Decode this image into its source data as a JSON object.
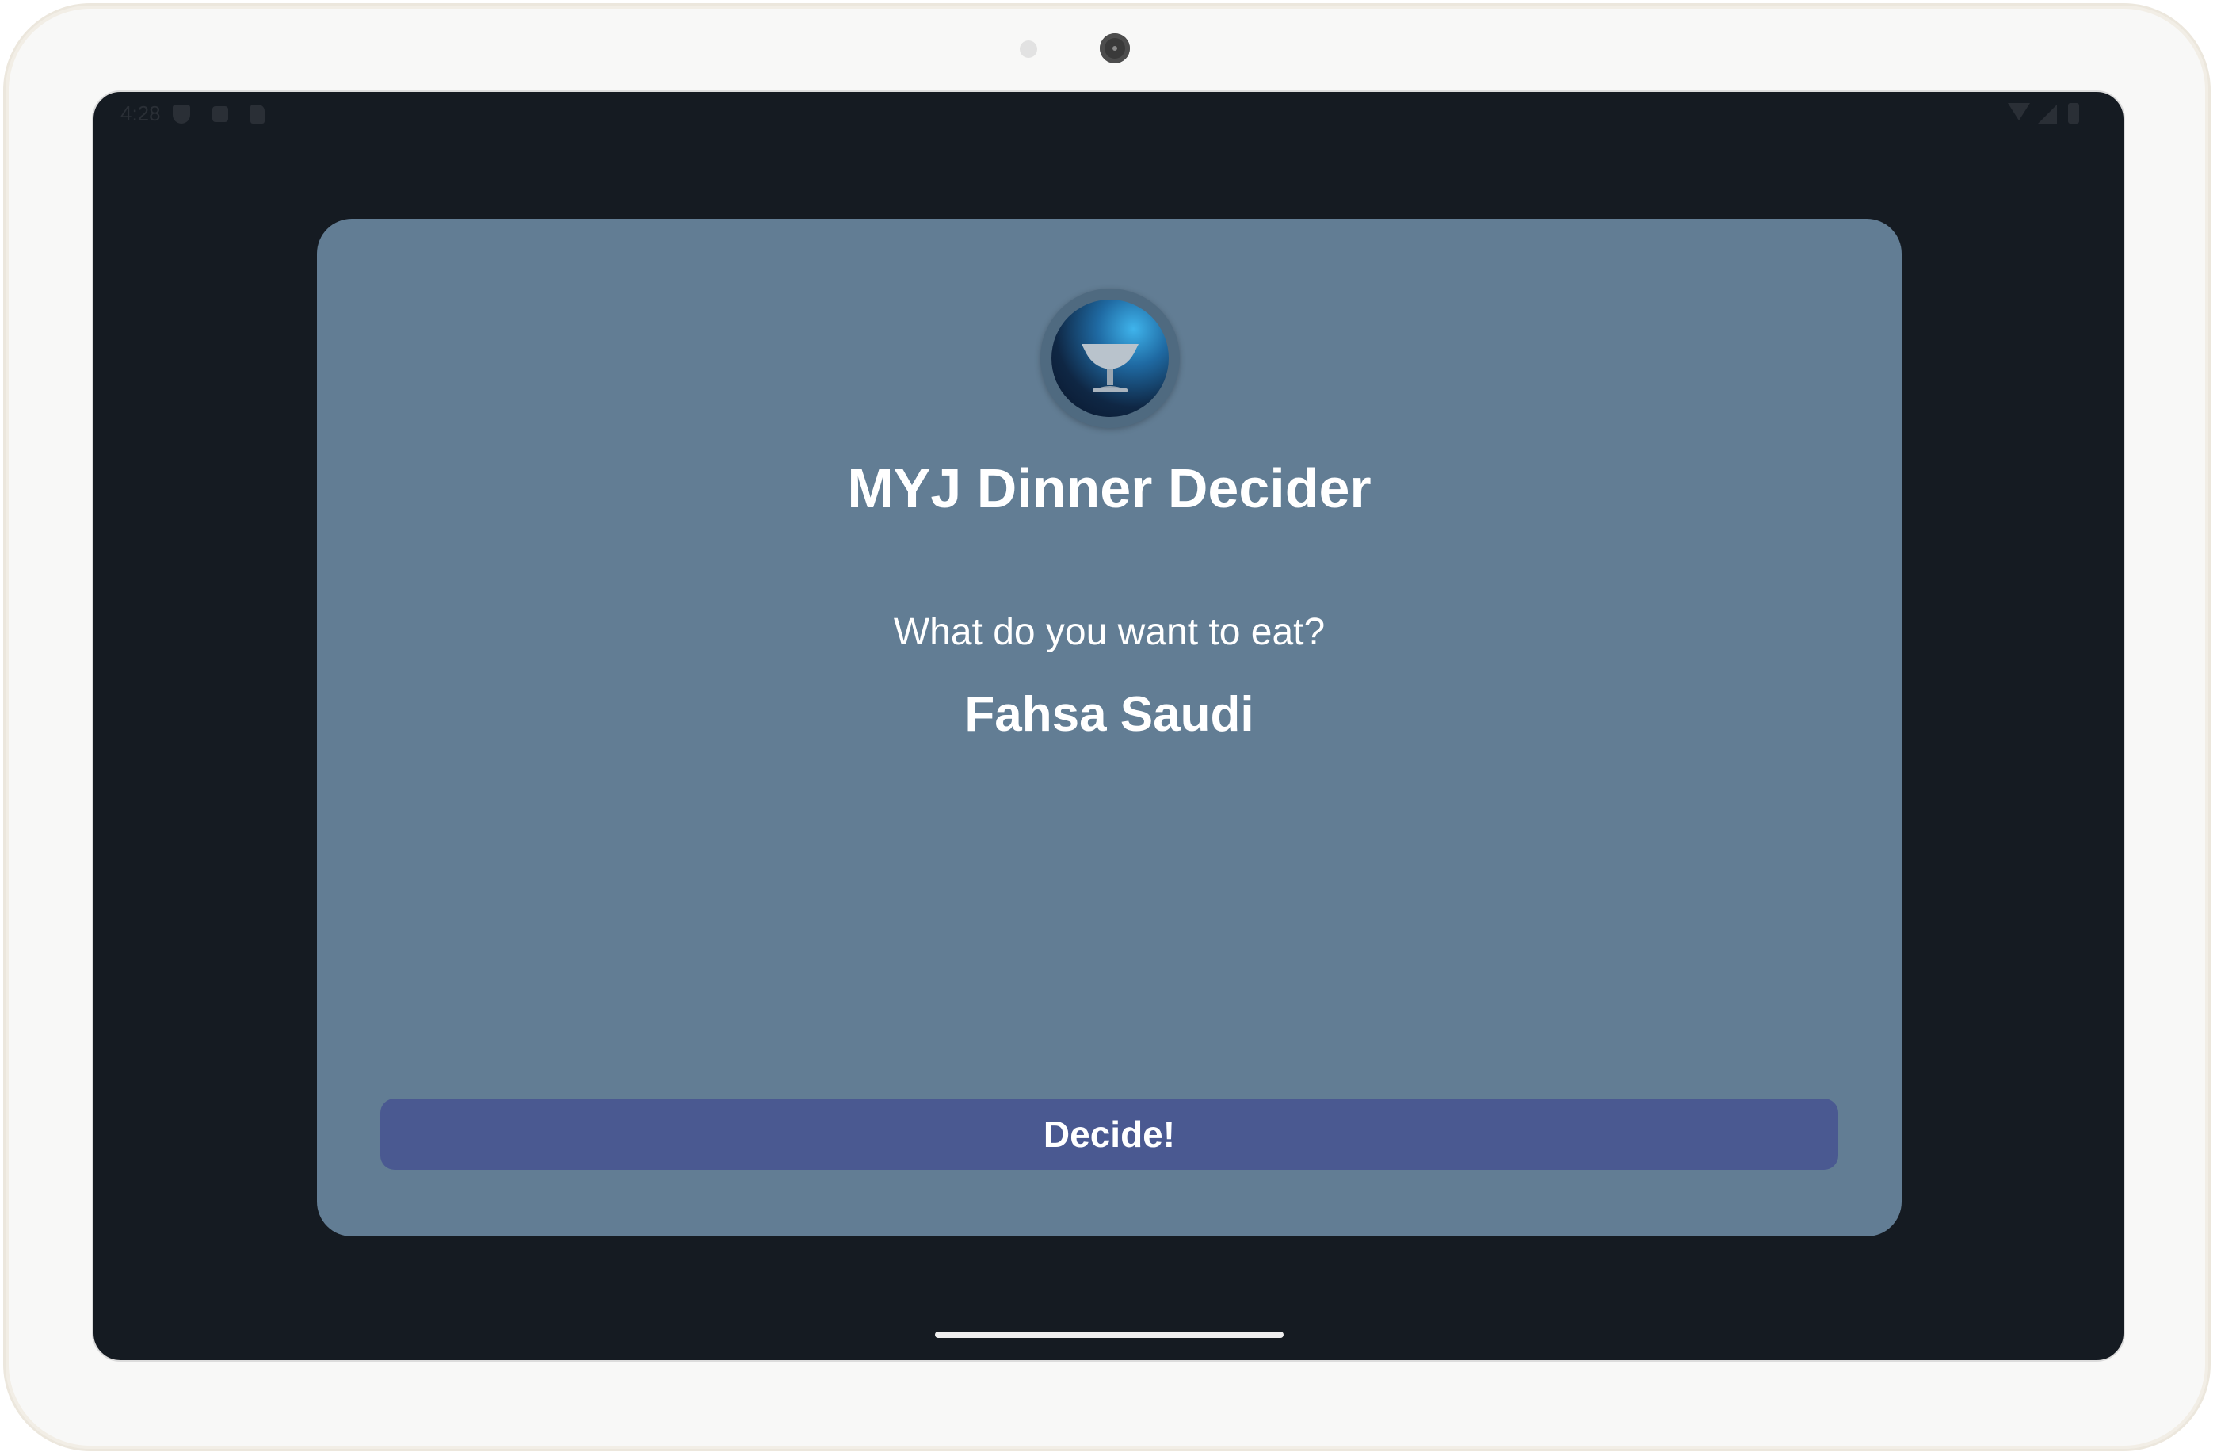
{
  "status_bar": {
    "time": "4:28",
    "left_icons": [
      "shield-icon",
      "a-icon",
      "sd-card-icon"
    ],
    "right_icons": [
      "wifi-icon",
      "signal-icon",
      "battery-icon"
    ]
  },
  "app": {
    "logo_icon": "dessert-glass-icon",
    "title": "MYJ Dinner Decider",
    "question": "What do you want to eat?",
    "answer": "Fahsa Saudi",
    "decide_label": "Decide!"
  },
  "colors": {
    "screen_background": "#151b22",
    "card_background": "#627d94",
    "button_background": "#4a5991",
    "text": "#ffffff"
  }
}
